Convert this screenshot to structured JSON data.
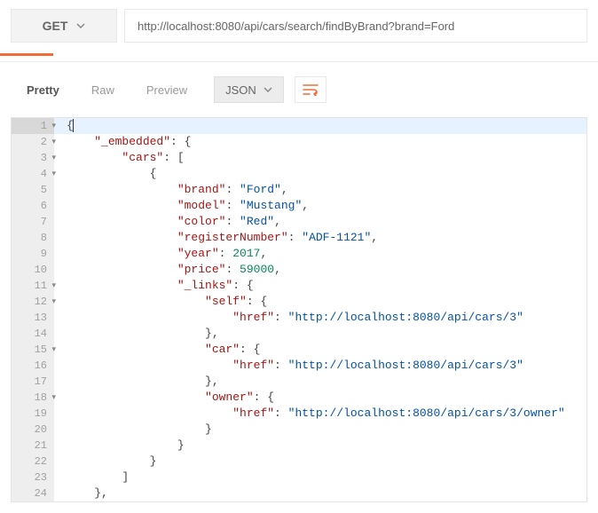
{
  "request": {
    "method": "GET",
    "url": "http://localhost:8080/api/cars/search/findByBrand?brand=Ford"
  },
  "tabs": {
    "pretty": "Pretty",
    "raw": "Raw",
    "preview": "Preview"
  },
  "format": {
    "label": "JSON"
  },
  "code": {
    "lines": [
      {
        "n": 1,
        "fold": true,
        "active": true,
        "indent": 0,
        "tokens": [
          [
            "punct",
            "{"
          ]
        ]
      },
      {
        "n": 2,
        "fold": true,
        "indent": 1,
        "tokens": [
          [
            "key",
            "\"_embedded\""
          ],
          [
            "punct",
            ": {"
          ]
        ]
      },
      {
        "n": 3,
        "fold": true,
        "indent": 2,
        "tokens": [
          [
            "key",
            "\"cars\""
          ],
          [
            "punct",
            ": ["
          ]
        ]
      },
      {
        "n": 4,
        "fold": true,
        "indent": 3,
        "tokens": [
          [
            "punct",
            "{"
          ]
        ]
      },
      {
        "n": 5,
        "fold": false,
        "indent": 4,
        "tokens": [
          [
            "key",
            "\"brand\""
          ],
          [
            "punct",
            ": "
          ],
          [
            "str",
            "\"Ford\""
          ],
          [
            "punct",
            ","
          ]
        ]
      },
      {
        "n": 6,
        "fold": false,
        "indent": 4,
        "tokens": [
          [
            "key",
            "\"model\""
          ],
          [
            "punct",
            ": "
          ],
          [
            "str",
            "\"Mustang\""
          ],
          [
            "punct",
            ","
          ]
        ]
      },
      {
        "n": 7,
        "fold": false,
        "indent": 4,
        "tokens": [
          [
            "key",
            "\"color\""
          ],
          [
            "punct",
            ": "
          ],
          [
            "str",
            "\"Red\""
          ],
          [
            "punct",
            ","
          ]
        ]
      },
      {
        "n": 8,
        "fold": false,
        "indent": 4,
        "tokens": [
          [
            "key",
            "\"registerNumber\""
          ],
          [
            "punct",
            ": "
          ],
          [
            "str",
            "\"ADF-1121\""
          ],
          [
            "punct",
            ","
          ]
        ]
      },
      {
        "n": 9,
        "fold": false,
        "indent": 4,
        "tokens": [
          [
            "key",
            "\"year\""
          ],
          [
            "punct",
            ": "
          ],
          [
            "num",
            "2017"
          ],
          [
            "punct",
            ","
          ]
        ]
      },
      {
        "n": 10,
        "fold": false,
        "indent": 4,
        "tokens": [
          [
            "key",
            "\"price\""
          ],
          [
            "punct",
            ": "
          ],
          [
            "num",
            "59000"
          ],
          [
            "punct",
            ","
          ]
        ]
      },
      {
        "n": 11,
        "fold": true,
        "indent": 4,
        "tokens": [
          [
            "key",
            "\"_links\""
          ],
          [
            "punct",
            ": {"
          ]
        ]
      },
      {
        "n": 12,
        "fold": true,
        "indent": 5,
        "tokens": [
          [
            "key",
            "\"self\""
          ],
          [
            "punct",
            ": {"
          ]
        ]
      },
      {
        "n": 13,
        "fold": false,
        "indent": 6,
        "tokens": [
          [
            "key",
            "\"href\""
          ],
          [
            "punct",
            ": "
          ],
          [
            "str",
            "\"http://localhost:8080/api/cars/3\""
          ]
        ]
      },
      {
        "n": 14,
        "fold": false,
        "indent": 5,
        "tokens": [
          [
            "punct",
            "},"
          ]
        ]
      },
      {
        "n": 15,
        "fold": true,
        "indent": 5,
        "tokens": [
          [
            "key",
            "\"car\""
          ],
          [
            "punct",
            ": {"
          ]
        ]
      },
      {
        "n": 16,
        "fold": false,
        "indent": 6,
        "tokens": [
          [
            "key",
            "\"href\""
          ],
          [
            "punct",
            ": "
          ],
          [
            "str",
            "\"http://localhost:8080/api/cars/3\""
          ]
        ]
      },
      {
        "n": 17,
        "fold": false,
        "indent": 5,
        "tokens": [
          [
            "punct",
            "},"
          ]
        ]
      },
      {
        "n": 18,
        "fold": true,
        "indent": 5,
        "tokens": [
          [
            "key",
            "\"owner\""
          ],
          [
            "punct",
            ": {"
          ]
        ]
      },
      {
        "n": 19,
        "fold": false,
        "indent": 6,
        "tokens": [
          [
            "key",
            "\"href\""
          ],
          [
            "punct",
            ": "
          ],
          [
            "str",
            "\"http://localhost:8080/api/cars/3/owner\""
          ]
        ]
      },
      {
        "n": 20,
        "fold": false,
        "indent": 5,
        "tokens": [
          [
            "punct",
            "}"
          ]
        ]
      },
      {
        "n": 21,
        "fold": false,
        "indent": 4,
        "tokens": [
          [
            "punct",
            "}"
          ]
        ]
      },
      {
        "n": 22,
        "fold": false,
        "indent": 3,
        "tokens": [
          [
            "punct",
            "}"
          ]
        ]
      },
      {
        "n": 23,
        "fold": false,
        "indent": 2,
        "tokens": [
          [
            "punct",
            "]"
          ]
        ]
      },
      {
        "n": 24,
        "fold": false,
        "indent": 1,
        "tokens": [
          [
            "punct",
            "},"
          ]
        ]
      }
    ]
  }
}
